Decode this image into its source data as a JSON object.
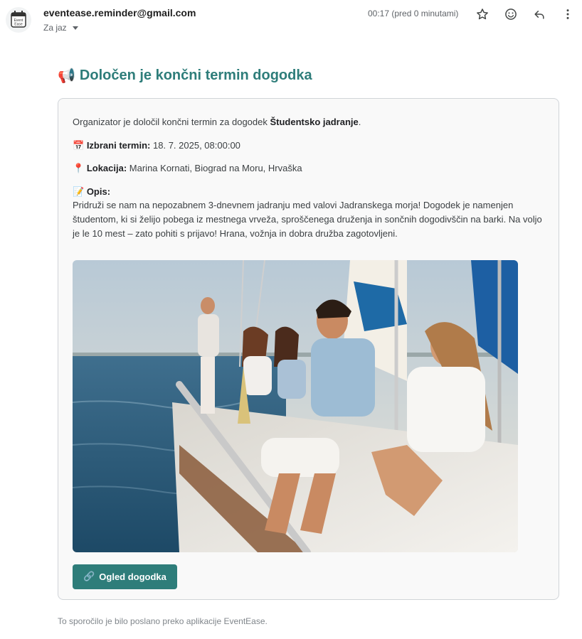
{
  "header": {
    "sender": "eventease.reminder@gmail.com",
    "to_label": "Za jaz",
    "time": "00:17 (pred 0 minutami)",
    "avatar_text_line1": "Event",
    "avatar_text_line2": "Ease"
  },
  "email": {
    "title_emoji": "📢",
    "title": "Določen je končni termin dogodka",
    "intro_prefix": "Organizator je določil končni termin za dogodek ",
    "event_name": "Študentsko jadranje",
    "intro_suffix": ".",
    "date_emoji": "📅",
    "date_label": "Izbrani termin:",
    "date_value": "18. 7. 2025, 08:00:00",
    "location_emoji": "📍",
    "location_label": "Lokacija:",
    "location_value": "Marina Kornati, Biograd na Moru, Hrvaška",
    "desc_emoji": "📝",
    "desc_label": "Opis:",
    "desc_text": "Pridruži se nam na nepozabnem 3-dnevnem jadranju med valovi Jadranskega morja! Dogodek je namenjen študentom, ki si želijo pobega iz mestnega vrveža, sproščenega druženja in sončnih dogodivščin na barki. Na voljo je le 10 mest – zato pohiti s prijavo! Hrana, vožnja in dobra družba zagotovljeni.",
    "button_emoji": "🔗",
    "button_label": "Ogled dogodka"
  },
  "footer": {
    "text": "To sporočilo je bilo poslano preko aplikacije EventEase."
  },
  "colors": {
    "accent": "#2e7d7a",
    "card_bg": "#f9f9f9",
    "card_border": "#d0d4d8"
  },
  "icons": {
    "star": "star-icon",
    "emoji": "emoji-icon",
    "reply": "reply-icon",
    "more": "more-vert-icon"
  }
}
